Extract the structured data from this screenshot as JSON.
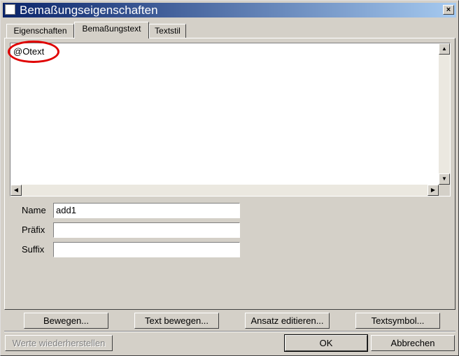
{
  "window": {
    "title": "Bemaßungseigenschaften",
    "close_glyph": "×"
  },
  "tabs": [
    {
      "label": "Eigenschaften",
      "active": false
    },
    {
      "label": "Bemaßungstext",
      "active": true
    },
    {
      "label": "Textstil",
      "active": false
    }
  ],
  "editor": {
    "text": "@Otext",
    "highlight_color": "#e00000"
  },
  "fields": {
    "name_label": "Name",
    "name_value": "add1",
    "prefix_label": "Präfix",
    "prefix_value": "",
    "suffix_label": "Suffix",
    "suffix_value": ""
  },
  "actions": {
    "bewegen": "Bewegen...",
    "text_bewegen": "Text bewegen...",
    "ansatz_editieren": "Ansatz editieren...",
    "textsymbol": "Textsymbol..."
  },
  "footer": {
    "restore": "Werte wiederherstellen",
    "ok": "OK",
    "cancel": "Abbrechen"
  }
}
